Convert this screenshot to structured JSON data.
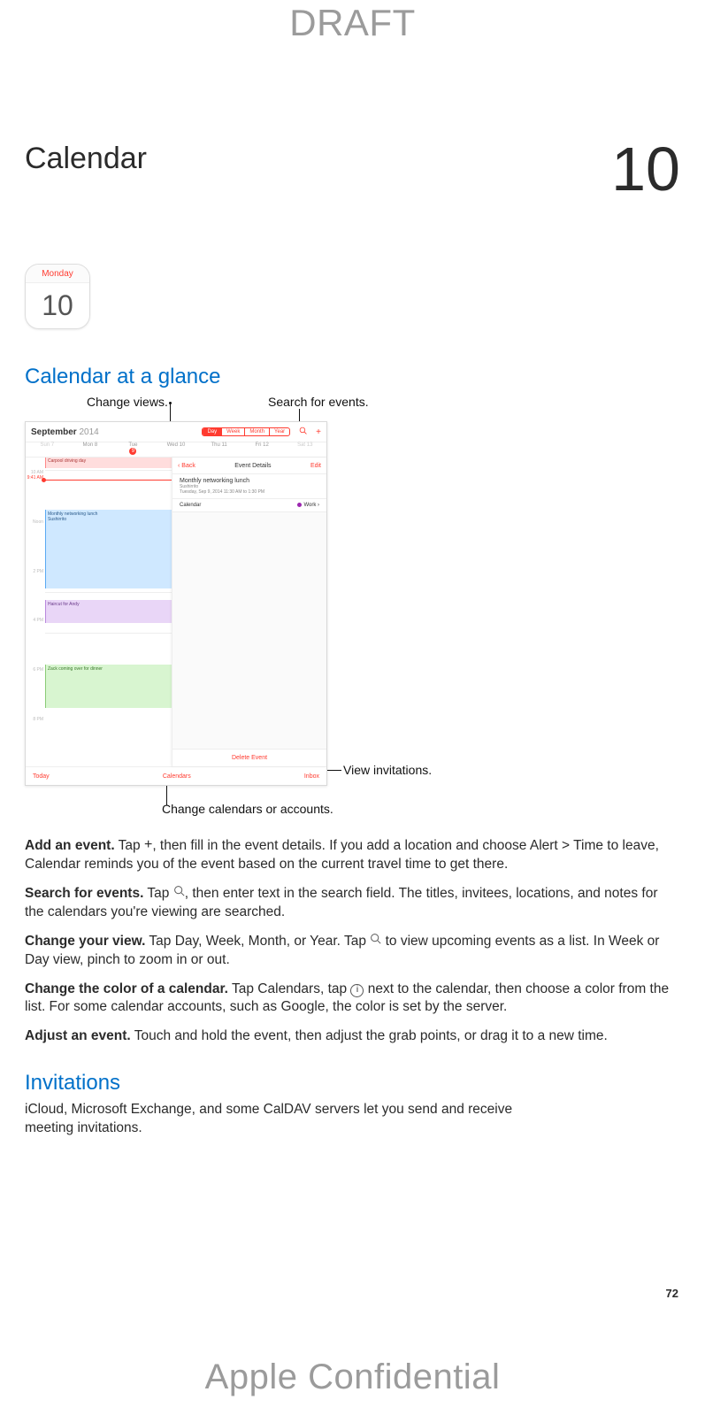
{
  "watermark": {
    "top": "DRAFT",
    "bottom": "Apple Confidential"
  },
  "chapter": {
    "title": "Calendar",
    "number": "10"
  },
  "app_icon": {
    "weekday": "Monday",
    "day": "10"
  },
  "section1_heading": "Calendar at a glance",
  "callouts": {
    "change_views": "Change views.",
    "search_for_events": "Search for events.",
    "view_invitations": "View invitations.",
    "change_calendars": "Change calendars or accounts."
  },
  "screenshot": {
    "month": "September",
    "year": "2014",
    "segmented": {
      "day": "Day",
      "week": "Week",
      "month": "Month",
      "year": "Year"
    },
    "days": {
      "sun": {
        "lbl": "Sun 7"
      },
      "mon": {
        "lbl": "Mon 8"
      },
      "tue": {
        "lbl": "Tue",
        "n": "9"
      },
      "wed": {
        "lbl": "Wed 10"
      },
      "thu": {
        "lbl": "Thu 11"
      },
      "fri": {
        "lbl": "Fri 12"
      },
      "sat": {
        "lbl": "Sat 13"
      }
    },
    "all_day_event": "Carpool driving day",
    "now_label": "9:41 AM",
    "times": {
      "t1": "10 AM",
      "t2": "Noon",
      "t3": "2 PM",
      "t4": "4 PM",
      "t5": "6 PM",
      "t6": "8 PM"
    },
    "events": {
      "blue": {
        "title": "Monthly networking lunch",
        "loc": "Sushirrito"
      },
      "purple": {
        "title": "Haircut for Andy"
      },
      "green": {
        "title": "Zack coming over for dinner"
      }
    },
    "detail": {
      "back": "Back",
      "title": "Event Details",
      "edit": "Edit",
      "event_title": "Monthly networking lunch",
      "event_loc": "Sushirrito",
      "event_time": "Tuesday, Sep 9, 2014    11:30 AM to 1:30 PM",
      "row_calendar_label": "Calendar",
      "row_calendar_value": "Work",
      "delete": "Delete Event"
    },
    "toolbar": {
      "today": "Today",
      "calendars": "Calendars",
      "inbox": "Inbox"
    }
  },
  "paragraphs": {
    "p1_b": "Add an event.",
    "p1": " Tap ",
    "p1_after": ", then fill in the event details. If you add a location and choose Alert > Time to leave, Calendar reminds you of the event based on the current travel time to get there.",
    "p2_b": "Search for events.",
    "p2": " Tap ",
    "p2_after": ", then enter text in the search field. The titles, invitees, locations, and notes for the calendars you're viewing are searched.",
    "p3_b": "Change your view.",
    "p3": " Tap Day, Week, Month, or Year. Tap ",
    "p3_after": " to view upcoming events as a list. In Week or Day view, pinch to zoom in or out.",
    "p4_b": "Change the color of a calendar.",
    "p4": " Tap Calendars, tap ",
    "p4_after": " next to the calendar, then choose a color from the list. For some calendar accounts, such as Google, the color is set by the server.",
    "p5_b": "Adjust an event.",
    "p5": " Touch and hold the event, then adjust the grab points, or drag it to a new time."
  },
  "section2_heading": "Invitations",
  "section2_body": "iCloud, Microsoft Exchange, and some CalDAV servers let you send and receive meeting invitations.",
  "page_number": "72"
}
